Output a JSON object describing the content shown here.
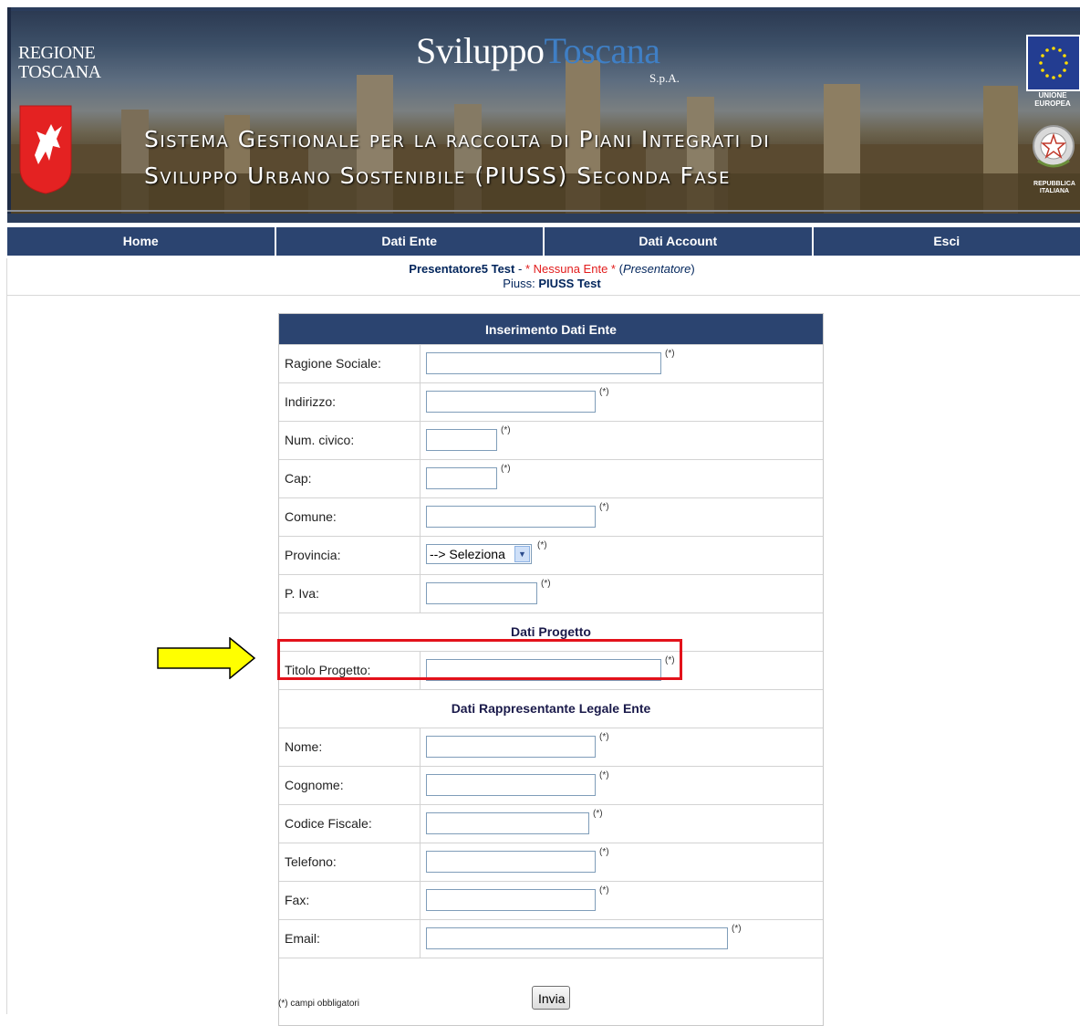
{
  "banner": {
    "regione_line1": "REGIONE",
    "regione_line2": "TOSCANA",
    "brand_part1": "Sviluppo",
    "brand_part2": "Toscana",
    "brand_spa": "S.p.A.",
    "subtitle_line1": "Sistema Gestionale per la raccolta di Piani Integrati di",
    "subtitle_line2": "Sviluppo Urbano Sostenibile (PIUSS) Seconda Fase",
    "eu_label_1": "UNIONE",
    "eu_label_2": "EUROPEA",
    "ri_label_1": "REPUBBLICA",
    "ri_label_2": "ITALIANA"
  },
  "nav": {
    "items": [
      "Home",
      "Dati Ente",
      "Dati Account",
      "Esci"
    ]
  },
  "user": {
    "name": "Presentatore5 Test",
    "separator": "-",
    "ente": "* Nessuna Ente *",
    "role": "Presentatore",
    "piuss_label": "Piuss:",
    "piuss_value": "PIUSS Test"
  },
  "form": {
    "title": "Inserimento Dati Ente",
    "required_mark": "(*)",
    "fields_ente": [
      {
        "label": "Ragione Sociale:",
        "value": ""
      },
      {
        "label": "Indirizzo:",
        "value": ""
      },
      {
        "label": "Num. civico:",
        "value": ""
      },
      {
        "label": "Cap:",
        "value": ""
      },
      {
        "label": "Comune:",
        "value": ""
      },
      {
        "label": "Provincia:",
        "selected": "--> Seleziona"
      },
      {
        "label": "P. Iva:",
        "value": ""
      }
    ],
    "section_progetto": "Dati Progetto",
    "field_titolo": {
      "label": "Titolo Progetto:",
      "value": ""
    },
    "section_rappresentante": "Dati Rappresentante Legale Ente",
    "fields_rappresentante": [
      {
        "label": "Nome:",
        "value": ""
      },
      {
        "label": "Cognome:",
        "value": ""
      },
      {
        "label": "Codice Fiscale:",
        "value": ""
      },
      {
        "label": "Telefono:",
        "value": ""
      },
      {
        "label": "Fax:",
        "value": ""
      },
      {
        "label": "Email:",
        "value": ""
      }
    ],
    "submit_label": "Invia",
    "footnote": "(*) campi obbligatori"
  },
  "colors": {
    "nav_bg": "#2b4470",
    "highlight": "#e3121b",
    "arrow_fill": "#ffff00",
    "ente_red": "#e21b1b"
  }
}
